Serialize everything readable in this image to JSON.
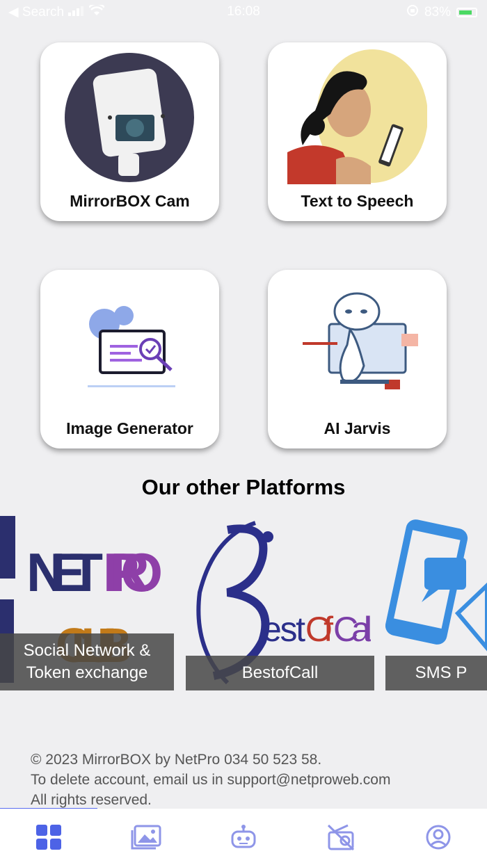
{
  "status_bar": {
    "back_label": "◀ Search",
    "time": "16:08",
    "battery": "83%"
  },
  "cards": [
    {
      "label": "MirrorBOX Cam",
      "icon": "security-camera-icon"
    },
    {
      "label": "Text to Speech",
      "icon": "woman-phone-icon"
    },
    {
      "label": "Image Generator",
      "icon": "image-generator-icon"
    },
    {
      "label": "AI Jarvis",
      "icon": "robot-icon"
    }
  ],
  "section_title": "Our other Platforms",
  "platforms": [
    {
      "logo_text": "NETPRO CLUB",
      "caption": "Social Network & Token exchange"
    },
    {
      "logo_text": "BestOfCall",
      "caption": "BestofCall"
    },
    {
      "logo_text": "SMS",
      "caption": "SMS P"
    }
  ],
  "footer": {
    "line1": "© 2023 MirrorBOX by NetPro 034 50 523 58.",
    "line2": "To delete account, email us in support@netproweb.com",
    "line3": "All rights reserved."
  },
  "tabs": [
    {
      "name": "home-tab",
      "icon": "grid-icon",
      "active": true
    },
    {
      "name": "gallery-tab",
      "icon": "gallery-icon",
      "active": false
    },
    {
      "name": "bot-tab",
      "icon": "robot-icon",
      "active": false
    },
    {
      "name": "radio-tab",
      "icon": "radio-off-icon",
      "active": false
    },
    {
      "name": "profile-tab",
      "icon": "user-circle-icon",
      "active": false
    }
  ],
  "colors": {
    "accent": "#5a6cf0",
    "tab_inactive": "#8e95e8",
    "background": "#efeff1"
  }
}
